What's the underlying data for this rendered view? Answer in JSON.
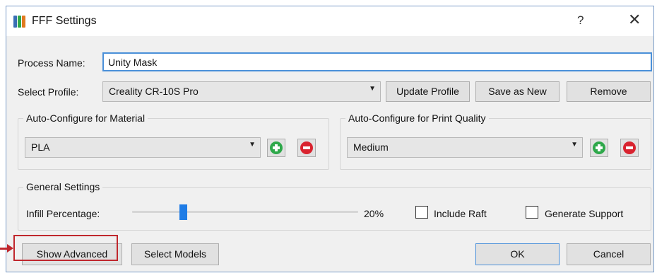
{
  "window": {
    "title": "FFF Settings",
    "help_label": "?",
    "close_label": "✕",
    "icon_colors": [
      "#3a6fb5",
      "#2ea84a",
      "#e07a1f"
    ]
  },
  "process": {
    "label": "Process Name:",
    "value": "Unity Mask"
  },
  "profile": {
    "label": "Select Profile:",
    "selected": "Creality CR-10S Pro",
    "update_label": "Update Profile",
    "save_new_label": "Save as New",
    "remove_label": "Remove"
  },
  "material": {
    "group_title": "Auto-Configure for Material",
    "selected": "PLA"
  },
  "quality": {
    "group_title": "Auto-Configure for Print Quality",
    "selected": "Medium"
  },
  "general": {
    "group_title": "General Settings",
    "infill_label": "Infill Percentage:",
    "infill_value_text": "20%",
    "infill_value": 0.2,
    "include_raft_label": "Include Raft",
    "include_raft_checked": false,
    "generate_support_label": "Generate Support",
    "generate_support_checked": false
  },
  "footer": {
    "show_advanced_label": "Show Advanced",
    "select_models_label": "Select Models",
    "ok_label": "OK",
    "cancel_label": "Cancel"
  },
  "annotation": {
    "highlight_color": "#c0272d"
  },
  "icons": {
    "add": "plus-circle-icon",
    "remove": "minus-circle-icon",
    "dropdown": "chevron-down-icon"
  }
}
